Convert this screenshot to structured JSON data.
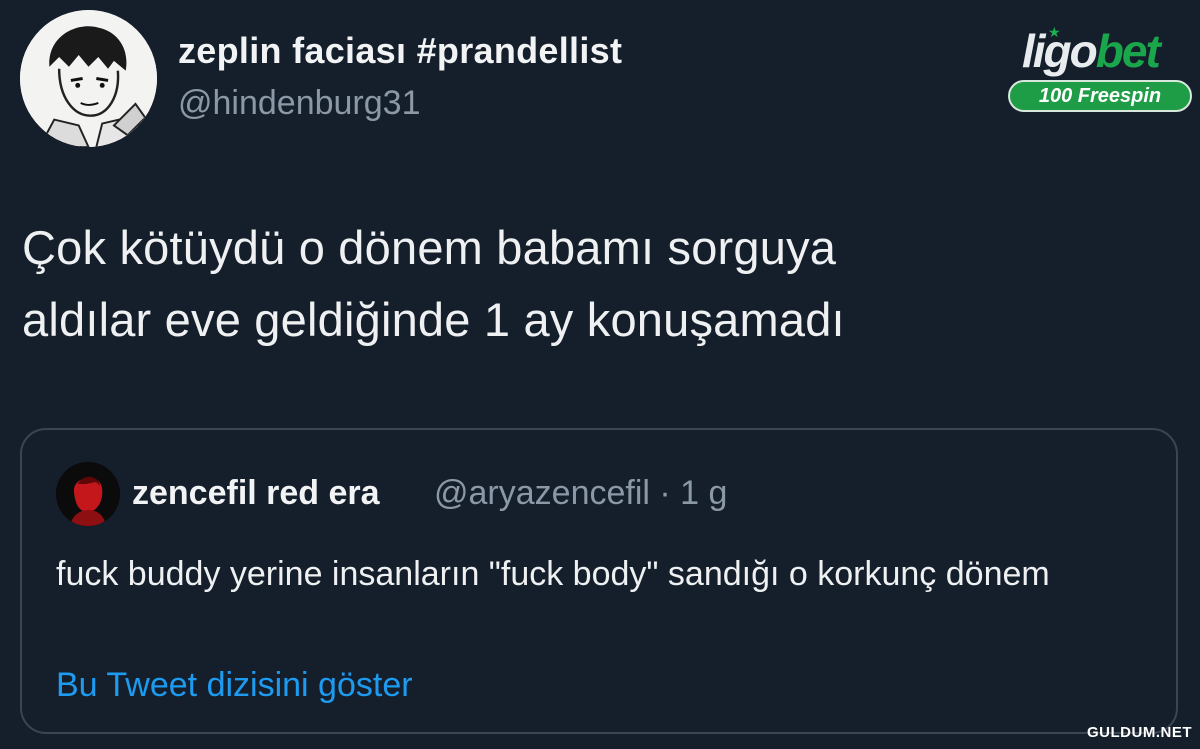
{
  "author": {
    "display_name": "zeplin faciası #prandellist",
    "handle": "@hindenburg31"
  },
  "ad": {
    "brand_part1": "ligo",
    "brand_part2": "bet",
    "badge": "100 Freespin",
    "brand_green": "#1aa64a"
  },
  "tweet": {
    "line1": "Çok kötüydü o dönem babamı sorguya",
    "line2": "aldılar eve geldiğinde 1 ay konuşamadı"
  },
  "quoted_tweet": {
    "display_name": "zencefil red era",
    "meta": "@aryazencefil · 1 g",
    "text": "fuck buddy yerine insanların \"fuck body\" sandığı o korkunç dönem",
    "thread_link": "Bu Tweet dizisini göster",
    "link_color": "#1d9bf0"
  },
  "watermark": "GULDUM.NET"
}
